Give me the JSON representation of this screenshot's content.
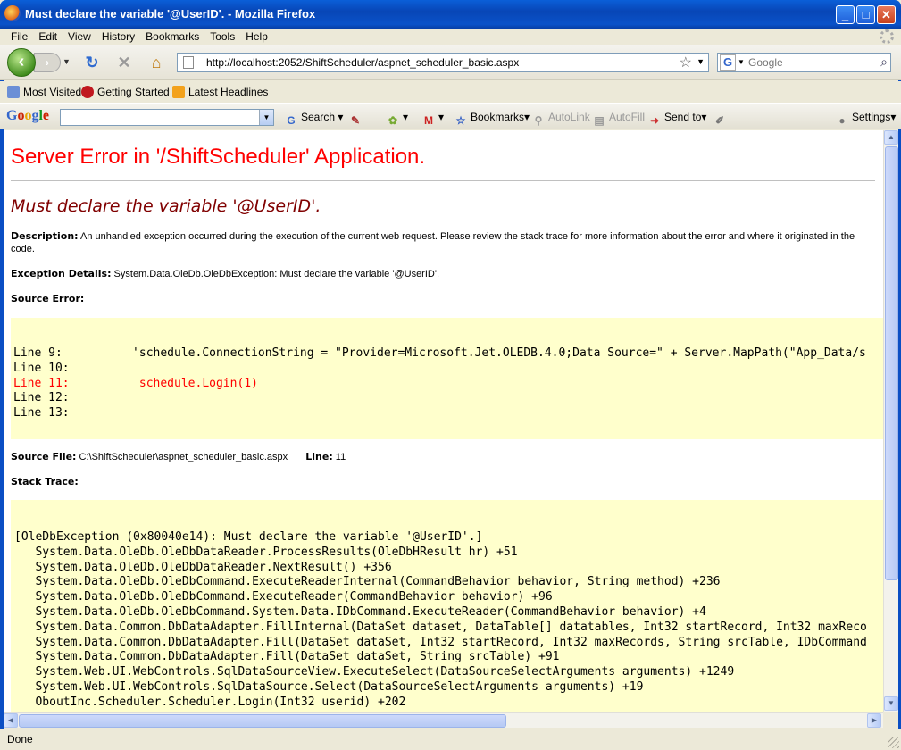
{
  "window": {
    "title": "Must declare the variable '@UserID'. - Mozilla Firefox",
    "minimize": "_",
    "maximize": "□",
    "close": "✕"
  },
  "menu": [
    "File",
    "Edit",
    "View",
    "History",
    "Bookmarks",
    "Tools",
    "Help"
  ],
  "nav": {
    "url": "http://localhost:2052/ShiftScheduler/aspnet_scheduler_basic.aspx",
    "search_placeholder": "Google"
  },
  "bookmarks": [
    "Most Visited",
    "Getting Started",
    "Latest Headlines"
  ],
  "google_toolbar": {
    "logo": [
      "G",
      "o",
      "o",
      "g",
      "l",
      "e"
    ],
    "search": "Search",
    "bookmarks": "Bookmarks",
    "autolink": "AutoLink",
    "autofill": "AutoFill",
    "sendto": "Send to",
    "settings": "Settings"
  },
  "page": {
    "title": "Server Error in '/ShiftScheduler' Application.",
    "error_message": "Must declare the variable '@UserID'.",
    "description_label": "Description:",
    "description_text": "An unhandled exception occurred during the execution of the current web request. Please review the stack trace for more information about the error and where it originated in the code.",
    "exception_label": "Exception Details:",
    "exception_text": "System.Data.OleDb.OleDbException: Must declare the variable '@UserID'.",
    "source_error_label": "Source Error:",
    "source_lines": [
      "Line 9:          'schedule.ConnectionString = \"Provider=Microsoft.Jet.OLEDB.4.0;Data Source=\" + Server.MapPath(\"App_Data/s",
      "Line 10:",
      "Line 11:          schedule.Login(1)",
      "Line 12:",
      "Line 13:"
    ],
    "source_file_label": "Source File:",
    "source_file": "C:\\ShiftScheduler\\aspnet_scheduler_basic.aspx",
    "line_label": "Line:",
    "line_number": "11",
    "stack_trace_label": "Stack Trace:",
    "stack_lines": [
      "[OleDbException (0x80040e14): Must declare the variable '@UserID'.]",
      "   System.Data.OleDb.OleDbDataReader.ProcessResults(OleDbHResult hr) +51",
      "   System.Data.OleDb.OleDbDataReader.NextResult() +356",
      "   System.Data.OleDb.OleDbCommand.ExecuteReaderInternal(CommandBehavior behavior, String method) +236",
      "   System.Data.OleDb.OleDbCommand.ExecuteReader(CommandBehavior behavior) +96",
      "   System.Data.OleDb.OleDbCommand.System.Data.IDbCommand.ExecuteReader(CommandBehavior behavior) +4",
      "   System.Data.Common.DbDataAdapter.FillInternal(DataSet dataset, DataTable[] datatables, Int32 startRecord, Int32 maxReco",
      "   System.Data.Common.DbDataAdapter.Fill(DataSet dataSet, Int32 startRecord, Int32 maxRecords, String srcTable, IDbCommand",
      "   System.Data.Common.DbDataAdapter.Fill(DataSet dataSet, String srcTable) +91",
      "   System.Web.UI.WebControls.SqlDataSourceView.ExecuteSelect(DataSourceSelectArguments arguments) +1249",
      "   System.Web.UI.WebControls.SqlDataSource.Select(DataSourceSelectArguments arguments) +19",
      "   OboutInc.Scheduler.Scheduler.Login(Int32 userid) +202"
    ]
  },
  "status": "Done"
}
